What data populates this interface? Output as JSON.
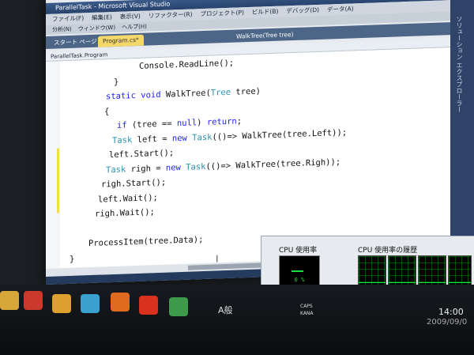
{
  "window": {
    "title": "ParallelTask - Microsoft Visual Studio",
    "menu_row1": [
      "ファイル(F)",
      "編集(E)",
      "表示(V)",
      "リファクター(R)",
      "プロジェクト(P)",
      "ビルド(B)",
      "デバッグ(D)",
      "データ(A)"
    ],
    "menu_row2": [
      "分析(N)",
      "ウィンドウ(W)",
      "ヘルプ(H)"
    ],
    "tabs": [
      {
        "label": "スタート ページ",
        "active": false
      },
      {
        "label": "Program.cs*",
        "active": true
      },
      {
        "label": "WalkTree(Tree tree)",
        "active": false
      }
    ],
    "nav_dropdown": "ParallelTask.Program",
    "right_panel_text": "ソリューション エクスプローラー"
  },
  "code": [
    {
      "indent": 88,
      "tokens": [
        {
          "t": "Console.ReadLine();",
          "k": "pl"
        }
      ]
    },
    {
      "indent": 56,
      "tokens": [
        {
          "t": "}",
          "k": "pl"
        }
      ]
    },
    {
      "indent": 46,
      "tokens": [
        {
          "t": "static ",
          "k": "kw"
        },
        {
          "t": "void ",
          "k": "kw"
        },
        {
          "t": "WalkTree(",
          "k": "pl"
        },
        {
          "t": "Tree",
          "k": "ty"
        },
        {
          "t": " tree)",
          "k": "pl"
        }
      ]
    },
    {
      "indent": 44,
      "tokens": [
        {
          "t": "{",
          "k": "pl"
        }
      ]
    },
    {
      "indent": 60,
      "tokens": [
        {
          "t": "if ",
          "k": "kw"
        },
        {
          "t": "(tree == ",
          "k": "pl"
        },
        {
          "t": "null",
          "k": "kw"
        },
        {
          "t": ") ",
          "k": "pl"
        },
        {
          "t": "return",
          "k": "kw"
        },
        {
          "t": ";",
          "k": "pl"
        }
      ]
    },
    {
      "indent": 54,
      "tokens": [
        {
          "t": "Task",
          "k": "ty"
        },
        {
          "t": " left = ",
          "k": "pl"
        },
        {
          "t": "new ",
          "k": "kw"
        },
        {
          "t": "Task",
          "k": "ty"
        },
        {
          "t": "(()=> WalkTree(tree.Left));",
          "k": "pl"
        }
      ]
    },
    {
      "indent": 50,
      "tokens": [
        {
          "t": "left.Start();",
          "k": "pl"
        }
      ]
    },
    {
      "indent": 46,
      "tokens": [
        {
          "t": "Task",
          "k": "ty"
        },
        {
          "t": " righ = ",
          "k": "pl"
        },
        {
          "t": "new ",
          "k": "kw"
        },
        {
          "t": "Task",
          "k": "ty"
        },
        {
          "t": "(()=> WalkTree(tree.Righ));",
          "k": "pl"
        }
      ]
    },
    {
      "indent": 40,
      "tokens": [
        {
          "t": "righ.Start();",
          "k": "pl"
        }
      ]
    },
    {
      "indent": 36,
      "tokens": [
        {
          "t": "left.Wait();",
          "k": "pl"
        }
      ]
    },
    {
      "indent": 32,
      "tokens": [
        {
          "t": "righ.Wait();",
          "k": "pl"
        }
      ]
    },
    {
      "indent": 0,
      "tokens": [
        {
          "t": "",
          "k": "pl"
        }
      ]
    },
    {
      "indent": 24,
      "tokens": [
        {
          "t": "ProcessItem(tree.Data);",
          "k": "pl"
        }
      ]
    },
    {
      "indent": 0,
      "tokens": [
        {
          "t": "}",
          "k": "pl"
        }
      ]
    }
  ],
  "task_manager": {
    "cpu_usage_title": "CPU 使用率",
    "cpu_history_title": "CPU 使用率の履歴",
    "cpu_usage_value": "0 %",
    "cpu_usage_fraction": 0.0
  },
  "taskbar": {
    "tray_ime": "A般",
    "caps": "CAPS",
    "kana": "KANA",
    "clock_time": "14:00",
    "clock_date": "2009/09/0"
  },
  "colors": {
    "keyword": "#1c1cff",
    "type": "#2b91af",
    "change_bar": "#f0e048",
    "cpu_green": "#19e03a"
  }
}
